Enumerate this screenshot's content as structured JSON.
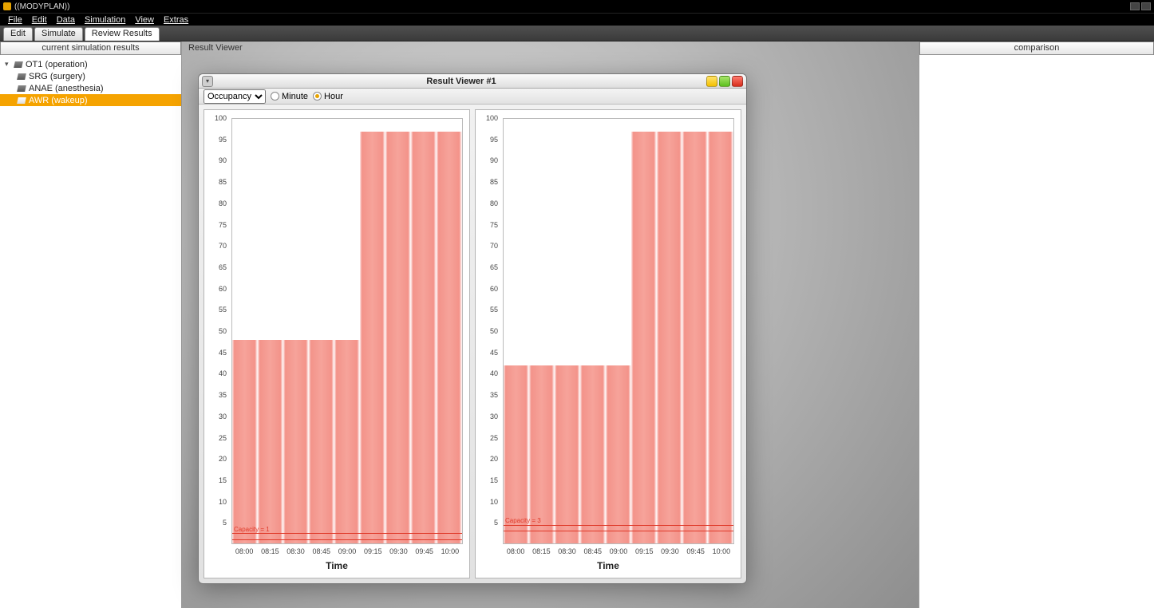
{
  "app": {
    "title": "((MODYPLAN))"
  },
  "menubar": [
    "File",
    "Edit",
    "Data",
    "Simulation",
    "View",
    "Extras"
  ],
  "tabs": [
    {
      "id": "edit",
      "label": "Edit"
    },
    {
      "id": "simulate",
      "label": "Simulate"
    },
    {
      "id": "review",
      "label": "Review Results"
    }
  ],
  "left_panel": {
    "header": "current simulation results",
    "tree": {
      "root": "OT1 (operation)",
      "children": [
        "SRG (surgery)",
        "ANAE (anesthesia)",
        "AWR (wakeup)"
      ],
      "selected_index": 2
    }
  },
  "center": {
    "header": "Result Viewer"
  },
  "inner_window": {
    "title": "Result Viewer #1",
    "dropdown": {
      "selected": "Occupancy"
    },
    "radios": {
      "minute": "Minute",
      "hour": "Hour",
      "selected": "hour"
    }
  },
  "right_panel": {
    "header": "comparison"
  },
  "chart_data": [
    {
      "type": "bar",
      "xlabel": "Time",
      "ylabel": "",
      "ylim": [
        0,
        100
      ],
      "yticks": [
        5,
        10,
        15,
        20,
        25,
        30,
        35,
        40,
        45,
        50,
        55,
        60,
        65,
        70,
        75,
        80,
        85,
        90,
        95,
        100
      ],
      "categories": [
        "08:00",
        "08:15",
        "08:30",
        "08:45",
        "09:00",
        "09:15",
        "09:30",
        "09:45",
        "10:00"
      ],
      "values": [
        48,
        48,
        48,
        48,
        48,
        97,
        97,
        97,
        97
      ],
      "capacity_label": "Capacity = 1",
      "capacity_value": 1
    },
    {
      "type": "bar",
      "xlabel": "Time",
      "ylabel": "",
      "ylim": [
        0,
        100
      ],
      "yticks": [
        5,
        10,
        15,
        20,
        25,
        30,
        35,
        40,
        45,
        50,
        55,
        60,
        65,
        70,
        75,
        80,
        85,
        90,
        95,
        100
      ],
      "categories": [
        "08:00",
        "08:15",
        "08:30",
        "08:45",
        "09:00",
        "09:15",
        "09:30",
        "09:45",
        "10:00"
      ],
      "values": [
        42,
        42,
        42,
        42,
        42,
        97,
        97,
        97,
        97
      ],
      "capacity_label": "Capacity = 3",
      "capacity_value": 3
    }
  ]
}
